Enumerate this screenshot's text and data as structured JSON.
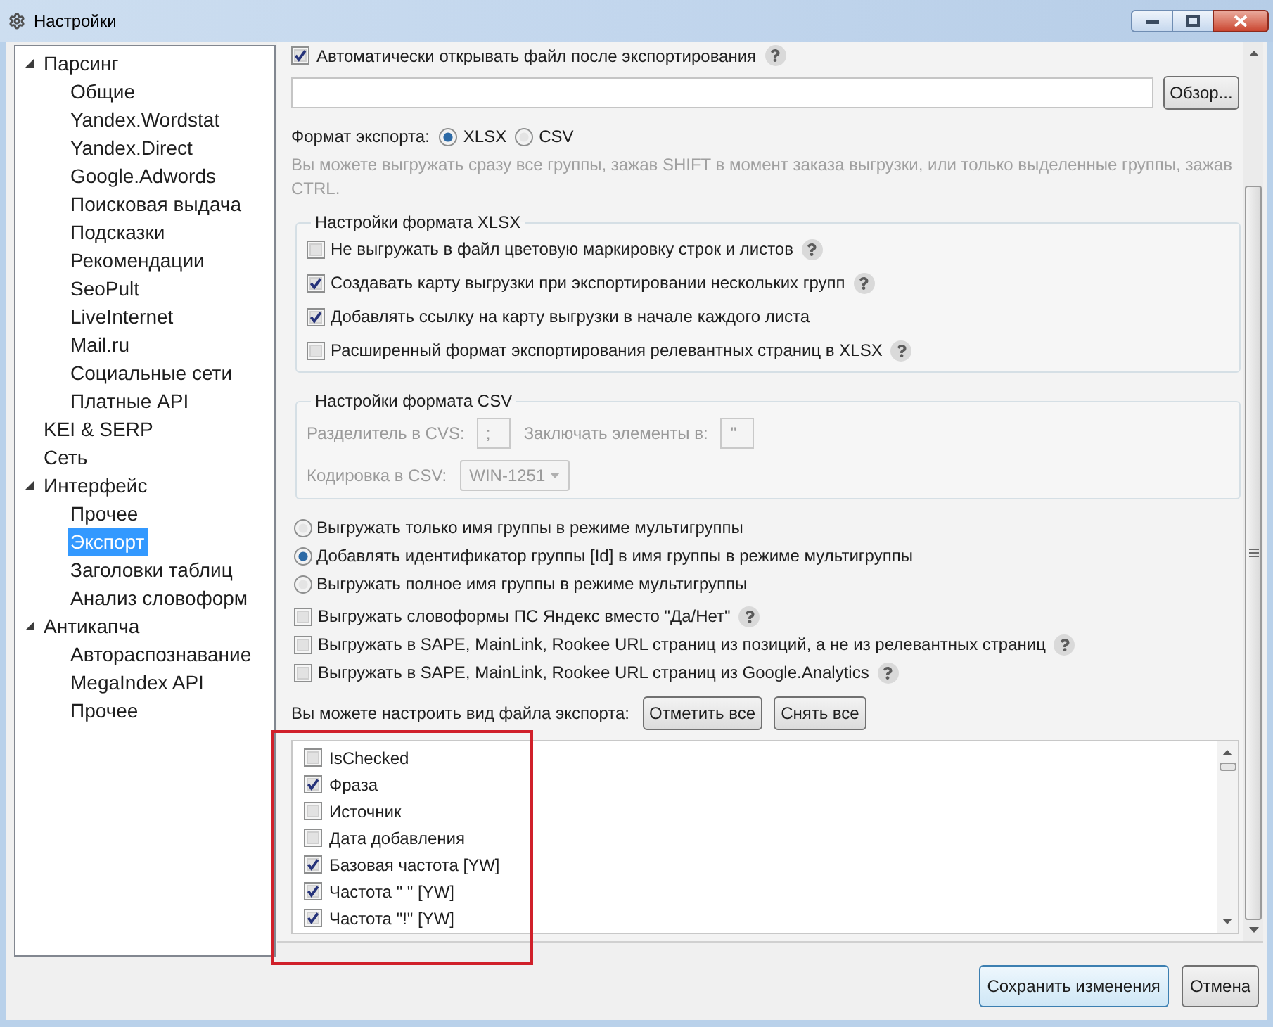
{
  "window": {
    "title": "Настройки"
  },
  "tree": [
    {
      "label": "Парсинг",
      "expanded": true,
      "selected": false,
      "children": [
        {
          "label": "Общие",
          "selected": false
        },
        {
          "label": "Yandex.Wordstat",
          "selected": false
        },
        {
          "label": "Yandex.Direct",
          "selected": false
        },
        {
          "label": "Google.Adwords",
          "selected": false
        },
        {
          "label": "Поисковая выдача",
          "selected": false
        },
        {
          "label": "Подсказки",
          "selected": false
        },
        {
          "label": "Рекомендации",
          "selected": false
        },
        {
          "label": "SeoPult",
          "selected": false
        },
        {
          "label": "LiveInternet",
          "selected": false
        },
        {
          "label": "Mail.ru",
          "selected": false
        },
        {
          "label": "Социальные сети",
          "selected": false
        },
        {
          "label": "Платные API",
          "selected": false
        }
      ]
    },
    {
      "label": "KEI & SERP",
      "selected": false
    },
    {
      "label": "Сеть",
      "selected": false
    },
    {
      "label": "Интерфейс",
      "expanded": true,
      "selected": false,
      "children": [
        {
          "label": "Прочее",
          "selected": false
        },
        {
          "label": "Экспорт",
          "selected": true
        },
        {
          "label": "Заголовки таблиц",
          "selected": false
        },
        {
          "label": "Анализ словоформ",
          "selected": false
        }
      ]
    },
    {
      "label": "Антикапча",
      "expanded": true,
      "selected": false,
      "children": [
        {
          "label": "Автораспознавание",
          "selected": false
        },
        {
          "label": "MegaIndex API",
          "selected": false
        },
        {
          "label": "Прочее",
          "selected": false
        }
      ]
    }
  ],
  "auto_open": {
    "label": "Автоматически открывать файл после экспортирования",
    "checked": true,
    "help": true
  },
  "path": {
    "button": "Обзор..."
  },
  "format": {
    "label": "Формат экспорта:",
    "options": [
      {
        "label": "XLSX",
        "selected": true
      },
      {
        "label": "CSV",
        "selected": false
      }
    ]
  },
  "note": "Вы можете выгружать сразу все группы, зажав SHIFT в момент заказа выгрузки, или только выделенные группы, зажав CTRL.",
  "xlsx": {
    "title": "Настройки формата XLSX",
    "options": [
      {
        "label": "Не выгружать в файл цветовую маркировку строк и листов",
        "checked": false,
        "help": true
      },
      {
        "label": "Создавать карту выгрузки при экспортировании нескольких групп",
        "checked": true,
        "help": true
      },
      {
        "label": "Добавлять ссылку на карту выгрузки в начале каждого листа",
        "checked": true,
        "help": false
      },
      {
        "label": "Расширенный формат экспортирования релевантных страниц в XLSX",
        "checked": false,
        "help": true
      }
    ]
  },
  "csv": {
    "title": "Настройки формата CSV",
    "disabled": true,
    "delimiter": {
      "label": "Разделитель в CVS:",
      "value": ";"
    },
    "quote": {
      "label": "Заключать элементы в:",
      "value": "\""
    },
    "encoding": {
      "label": "Кодировка в CSV:",
      "value": "WIN-1251"
    }
  },
  "group_mode": [
    {
      "label": "Выгружать только имя группы в режиме мультигруппы",
      "selected": false
    },
    {
      "label": "Добавлять идентификатор группы [Id] в имя группы в режиме мультигруппы",
      "selected": true
    },
    {
      "label": "Выгружать полное имя группы в режиме мультигруппы",
      "selected": false
    }
  ],
  "extra": [
    {
      "label": "Выгружать словоформы ПС Яндекс вместо \"Да/Нет\"",
      "checked": false,
      "help": true
    },
    {
      "label": "Выгружать в SAPE, MainLink, Rookee URL страниц из позиций, а не из релевантных страниц",
      "checked": false,
      "help": true
    },
    {
      "label": "Выгружать в SAPE, MainLink, Rookee URL страниц из Google.Analytics",
      "checked": false,
      "help": true
    }
  ],
  "columns_bar": {
    "label": "Вы можете настроить вид файла экспорта:",
    "buttons": [
      {
        "label": "Отметить все"
      },
      {
        "label": "Снять все"
      }
    ]
  },
  "columns": [
    {
      "label": "IsChecked",
      "checked": false
    },
    {
      "label": "Фраза",
      "checked": true
    },
    {
      "label": "Источник",
      "checked": false
    },
    {
      "label": "Дата добавления",
      "checked": false
    },
    {
      "label": "Базовая частота [YW]",
      "checked": true
    },
    {
      "label": "Частота \" \" [YW]",
      "checked": true
    },
    {
      "label": "Частота \"!\" [YW]",
      "checked": true
    }
  ],
  "footer": [
    {
      "label": "Сохранить изменения",
      "default": true
    },
    {
      "label": "Отмена",
      "default": false
    }
  ]
}
